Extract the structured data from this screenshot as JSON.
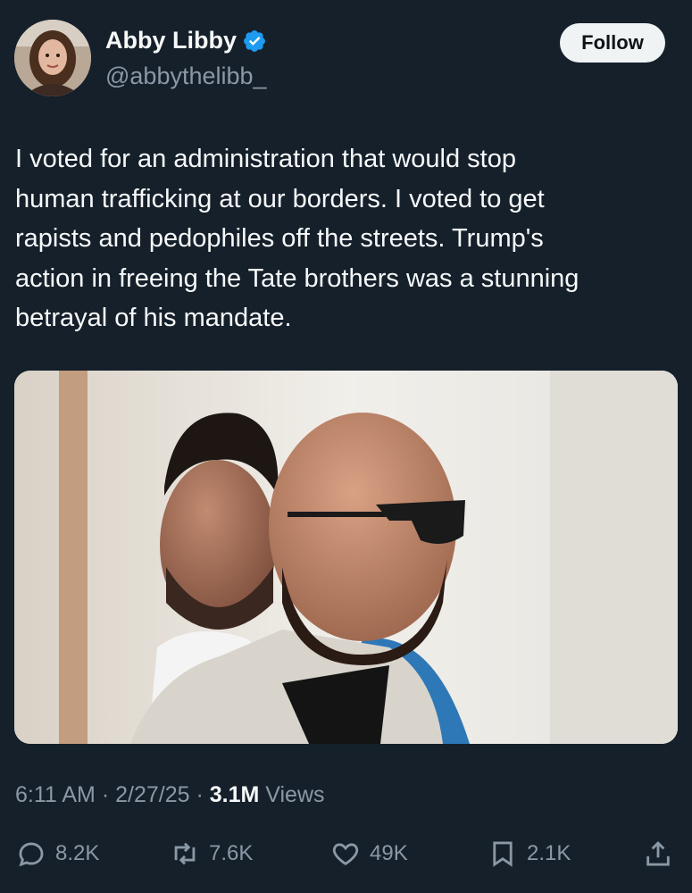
{
  "user": {
    "display_name": "Abby Libby",
    "handle": "@abbythelibb_",
    "verified": true
  },
  "follow_button": {
    "label": "Follow"
  },
  "tweet": {
    "lines": [
      "I voted for an administration that would stop",
      "human trafficking at our borders. I voted to get",
      "rapists and pedophiles off the streets. Trump's",
      "action in freeing the Tate brothers was a stunning",
      "betrayal of his mandate."
    ]
  },
  "meta": {
    "time": "6:11 AM",
    "sep1": " · ",
    "date": "2/27/25",
    "sep2": " · ",
    "views_count": "3.1M",
    "views_label": " Views"
  },
  "actions": {
    "replies": "8.2K",
    "reposts": "7.6K",
    "likes": "49K",
    "bookmarks": "2.1K"
  },
  "colors": {
    "background": "#15202b",
    "text": "#f7f9f9",
    "secondary": "#8b98a5",
    "verified": "#1d9bf0"
  },
  "icons": [
    "verified-badge-icon",
    "reply-icon",
    "repost-icon",
    "like-icon",
    "bookmark-icon",
    "share-icon"
  ]
}
